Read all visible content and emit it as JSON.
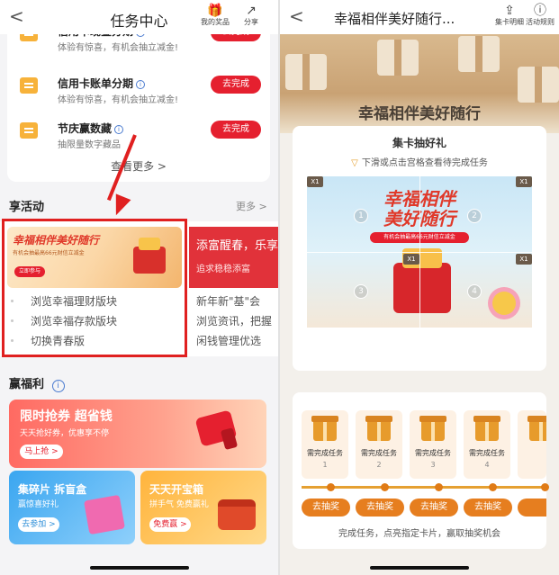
{
  "left": {
    "header": {
      "back": "<",
      "title": "任务中心",
      "prize_label": "我的奖品",
      "share_label": "分享"
    },
    "tasks": [
      {
        "name": "信用卡现金分期",
        "desc": "体验有惊喜，有机会抽立减金!",
        "button": "去完成"
      },
      {
        "name": "信用卡账单分期",
        "desc": "体验有惊喜，有机会抽立减金!",
        "button": "去完成"
      },
      {
        "name": "节庆赢数藏",
        "desc": "抽限量数字藏品",
        "button": "去完成"
      }
    ],
    "more_tasks": "查看更多 >",
    "activity_section": {
      "title": "享活动",
      "more": "更多 >"
    },
    "activity1": {
      "banner_title": "幸福相伴美好随行",
      "banner_sub": "有机会抽最高66元财信立减金",
      "banner_btn": "立即参与",
      "items": [
        "浏览幸福理财版块",
        "浏览幸福存款版块",
        "切换青春版"
      ]
    },
    "activity2": {
      "banner_title": "添富醒春，乐享",
      "banner_sub": "追求稳稳添富",
      "items": [
        "新年新\"基\"会",
        "浏览资讯，把握",
        "闲钱管理优选"
      ]
    },
    "welfare_section": {
      "title": "赢福利",
      "info": "i"
    },
    "welfare_big": {
      "title": "限时抢券 超省钱",
      "sub": "天天抢好券，优惠享不停",
      "button": "马上抢 >"
    },
    "welfare_small": [
      {
        "title": "集碎片 拆盲盒",
        "sub": "赢惊喜好礼",
        "button": "去参加 >"
      },
      {
        "title": "天天开宝箱",
        "sub": "拼手气 免费赢礼",
        "button": "免费赢 >"
      }
    ]
  },
  "right": {
    "header": {
      "back": "<",
      "title": "幸福相伴美好随行...",
      "share_label": "集卡明细",
      "rules_label": "活动规则"
    },
    "main_title": "幸福相伴美好随行",
    "card_title": "集卡抽好礼",
    "hint": "下滑或点击宫格查看待完成任务",
    "grid": {
      "title_line1": "幸福相伴",
      "title_line2": "美好随行",
      "pill": "有机会抽最高66元财信立减金",
      "badge": "X1",
      "cells": [
        "1",
        "2",
        "3",
        "4"
      ]
    },
    "gifts": [
      {
        "label": "需完成任务",
        "num": "1"
      },
      {
        "label": "需完成任务",
        "num": "2"
      },
      {
        "label": "需完成任务",
        "num": "3"
      },
      {
        "label": "需完成任务",
        "num": "4"
      }
    ],
    "draw_label": "去抽奖",
    "footer": "完成任务，点亮指定卡片，赢取抽奖机会"
  },
  "colors": {
    "red": "#e5202f",
    "orange": "#e67e1f",
    "annotation": "#e02020"
  }
}
